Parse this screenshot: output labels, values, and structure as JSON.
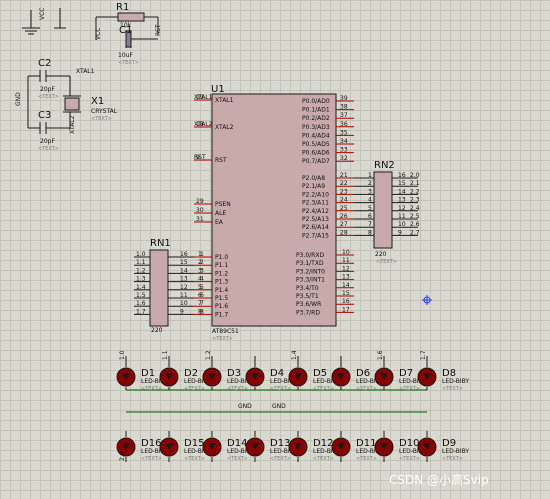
{
  "labels": {
    "vcc_top": "VCC",
    "r1": "R1",
    "r1_val": "10k",
    "vcc_r1": "VCC",
    "rst_r1": "RST",
    "c1": "C1",
    "c1_val": "10uF",
    "text_ph": "<TEXT>",
    "c2": "C2",
    "c2_val": "20pF",
    "xtal1_net": "XTAL1",
    "c3": "C3",
    "c3_val": "20pF",
    "gnd_left": "GND",
    "x1": "X1",
    "x1_type": "CRYSTAL",
    "xtal2_net": "XTAL2",
    "u1": "U1",
    "u1_part": "AT89C51",
    "rn2": "RN2",
    "rn2_val": "220",
    "rn1": "RN1",
    "rn1_val": "220",
    "gnd_led_1": "GND",
    "gnd_led_2": "GND"
  },
  "u1_left_pins": [
    {
      "num": "19",
      "name": "XTAL1",
      "net": "XTAL1"
    },
    {
      "num": "18",
      "name": "XTAL2",
      "net": "XTAL2"
    },
    {
      "num": "9",
      "name": "RST",
      "net": "RST"
    },
    {
      "num": "29",
      "name": "PSEN",
      "net": ""
    },
    {
      "num": "30",
      "name": "ALE",
      "net": ""
    },
    {
      "num": "31",
      "name": "EA",
      "net": ""
    }
  ],
  "u1_right_pins": [
    {
      "num": "39",
      "name": "P0.0/AD0"
    },
    {
      "num": "38",
      "name": "P0.1/AD1"
    },
    {
      "num": "37",
      "name": "P0.2/AD2"
    },
    {
      "num": "36",
      "name": "P0.3/AD3"
    },
    {
      "num": "35",
      "name": "P0.4/AD4"
    },
    {
      "num": "34",
      "name": "P0.5/AD5"
    },
    {
      "num": "33",
      "name": "P0.6/AD6"
    },
    {
      "num": "32",
      "name": "P0.7/AD7"
    },
    {
      "num": "21",
      "name": "P2.0/A8"
    },
    {
      "num": "22",
      "name": "P2.1/A9"
    },
    {
      "num": "23",
      "name": "P2.2/A10"
    },
    {
      "num": "24",
      "name": "P2.3/A11"
    },
    {
      "num": "25",
      "name": "P2.4/A12"
    },
    {
      "num": "26",
      "name": "P2.5/A13"
    },
    {
      "num": "27",
      "name": "P2.6/A14"
    },
    {
      "num": "28",
      "name": "P2.7/A15"
    }
  ],
  "u1_port1_pins": [
    {
      "num": "1",
      "name": "P1.0"
    },
    {
      "num": "2",
      "name": "P1.1"
    },
    {
      "num": "3",
      "name": "P1.2"
    },
    {
      "num": "4",
      "name": "P1.3"
    },
    {
      "num": "5",
      "name": "P1.4"
    },
    {
      "num": "6",
      "name": "P1.5"
    },
    {
      "num": "7",
      "name": "P1.6"
    },
    {
      "num": "8",
      "name": "P1.7"
    }
  ],
  "u1_port3_pins": [
    {
      "num": "10",
      "name": "P3.0/RXD"
    },
    {
      "num": "11",
      "name": "P3.1/TXD"
    },
    {
      "num": "12",
      "name": "P3.2/INT0"
    },
    {
      "num": "13",
      "name": "P3.3/INT1"
    },
    {
      "num": "14",
      "name": "P3.4/T0"
    },
    {
      "num": "15",
      "name": "P3.5/T1"
    },
    {
      "num": "16",
      "name": "P3.6/WR"
    },
    {
      "num": "17",
      "name": "P3.7/RD"
    }
  ],
  "rn2_pins": [
    {
      "left": "1",
      "right": "16",
      "net": "2.0"
    },
    {
      "left": "2",
      "right": "15",
      "net": "2.1"
    },
    {
      "left": "3",
      "right": "14",
      "net": "2.2"
    },
    {
      "left": "4",
      "right": "13",
      "net": "2.3"
    },
    {
      "left": "5",
      "right": "12",
      "net": "2.4"
    },
    {
      "left": "6",
      "right": "11",
      "net": "2.5"
    },
    {
      "left": "7",
      "right": "10",
      "net": "2.6"
    },
    {
      "left": "8",
      "right": "9",
      "net": "2.7"
    }
  ],
  "rn1_pins": [
    {
      "net": "1.0",
      "left": "1",
      "right": "16"
    },
    {
      "net": "1.1",
      "left": "2",
      "right": "15"
    },
    {
      "net": "1.2",
      "left": "3",
      "right": "14"
    },
    {
      "net": "1.3",
      "left": "4",
      "right": "13"
    },
    {
      "net": "1.4",
      "left": "5",
      "right": "12"
    },
    {
      "net": "1.5",
      "left": "6",
      "right": "11"
    },
    {
      "net": "1.6",
      "left": "7",
      "right": "10"
    },
    {
      "net": "1.7",
      "left": "8",
      "right": "9"
    }
  ],
  "leds_top": [
    {
      "id": "D1",
      "type": "LED-BIBY",
      "net": "1.0"
    },
    {
      "id": "D2",
      "type": "LED-BIBY",
      "net": "1.1"
    },
    {
      "id": "D3",
      "type": "LED-BIBY",
      "net": "1.2"
    },
    {
      "id": "D4",
      "type": "LED-BIBY",
      "net": ""
    },
    {
      "id": "D5",
      "type": "LED-BIBY",
      "net": "1.4"
    },
    {
      "id": "D6",
      "type": "LED-BIBY",
      "net": ""
    },
    {
      "id": "D7",
      "type": "LED-BIBY",
      "net": "1.6"
    },
    {
      "id": "D8",
      "type": "LED-BIBY",
      "net": "1.7"
    }
  ],
  "leds_bottom": [
    {
      "id": "D16",
      "type": "LED-BIBY",
      "net": "2.0"
    },
    {
      "id": "D15",
      "type": "LED-BIBY",
      "net": ""
    },
    {
      "id": "D14",
      "type": "LED-BIBY",
      "net": ""
    },
    {
      "id": "D13",
      "type": "LED-BIBY",
      "net": ""
    },
    {
      "id": "D12",
      "type": "LED-BIBY",
      "net": ""
    },
    {
      "id": "D11",
      "type": "LED-BIBY",
      "net": ""
    },
    {
      "id": "D10",
      "type": "LED-BIBY",
      "net": ""
    },
    {
      "id": "D9",
      "type": "LED-BIBY",
      "net": ""
    }
  ],
  "watermark": "CSDN @小高Svip"
}
